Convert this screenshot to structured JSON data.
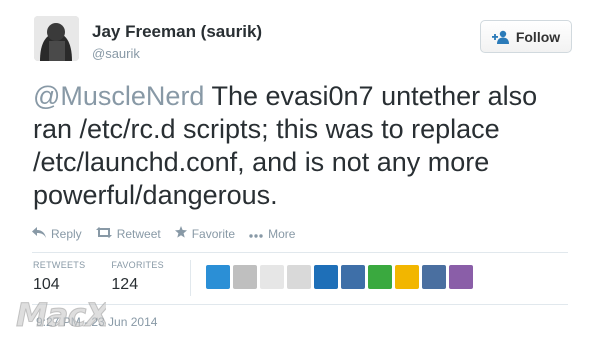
{
  "user": {
    "name": "Jay Freeman (saurik)",
    "handle": "@saurik"
  },
  "follow": {
    "label": "Follow"
  },
  "tweet": {
    "mention": "@MuscleNerd",
    "body": " The evasi0n7 untether also ran /etc/rc.d scripts; this was to replace /etc/launchd.conf, and is not any more powerful/dangerous."
  },
  "actions": {
    "reply": "Reply",
    "retweet": "Retweet",
    "favorite": "Favorite",
    "more": "More"
  },
  "stats": {
    "retweets_label": "RETWEETS",
    "retweets_value": "104",
    "favorites_label": "FAVORITES",
    "favorites_value": "124"
  },
  "favoriter_avatars": [
    {
      "name": "g-logo",
      "color": "#2b8fd6"
    },
    {
      "name": "usb-stick",
      "color": "#bfbfbf"
    },
    {
      "name": "person-portrait",
      "color": "#e6e6e6"
    },
    {
      "name": "cat",
      "color": "#d9d9d9"
    },
    {
      "name": "stripes",
      "color": "#1e6fb8"
    },
    {
      "name": "figure-blue",
      "color": "#3e6fa8"
    },
    {
      "name": "soccer-ball",
      "color": "#3aa93f"
    },
    {
      "name": "penguin",
      "color": "#f2b600"
    },
    {
      "name": "silhouette",
      "color": "#4a6fa0"
    },
    {
      "name": "pixel-art",
      "color": "#8a5ea8"
    }
  ],
  "timestamp": "9:27 PM - 23 Jun 2014",
  "watermark": "MacX",
  "colors": {
    "accent": "#2b7bb9",
    "muted": "#8899a6",
    "text": "#292f33"
  }
}
